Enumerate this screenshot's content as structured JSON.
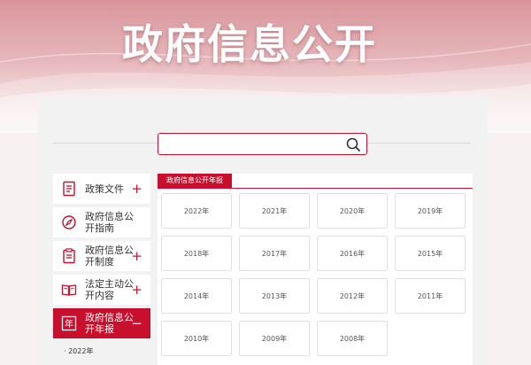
{
  "banner": {
    "title": "政府信息公开"
  },
  "search": {
    "placeholder": ""
  },
  "sidebar": {
    "items": [
      {
        "label": "政策文件",
        "icon": "document-icon",
        "sign": "+"
      },
      {
        "label": "政府信息公开指南",
        "icon": "compass-icon",
        "sign": ""
      },
      {
        "label": "政府信息公开制度",
        "icon": "clipboard-icon",
        "sign": "+"
      },
      {
        "label": "法定主动公开内容",
        "icon": "book-icon",
        "sign": "+"
      },
      {
        "label": "政府信息公开年报",
        "icon": "year-icon",
        "sign": "−",
        "active": true
      }
    ],
    "sub_items": [
      "2022年"
    ],
    "year_icon_char": "年"
  },
  "content": {
    "tab_label": "政府信息公开年报",
    "years": [
      "2022年",
      "2021年",
      "2020年",
      "2019年",
      "2018年",
      "2017年",
      "2016年",
      "2015年",
      "2014年",
      "2013年",
      "2012年",
      "2011年",
      "2010年",
      "2009年",
      "2008年"
    ]
  },
  "colors": {
    "accent": "#c8102e",
    "banner_top": "#d8959b",
    "background": "#f7f1f2"
  }
}
